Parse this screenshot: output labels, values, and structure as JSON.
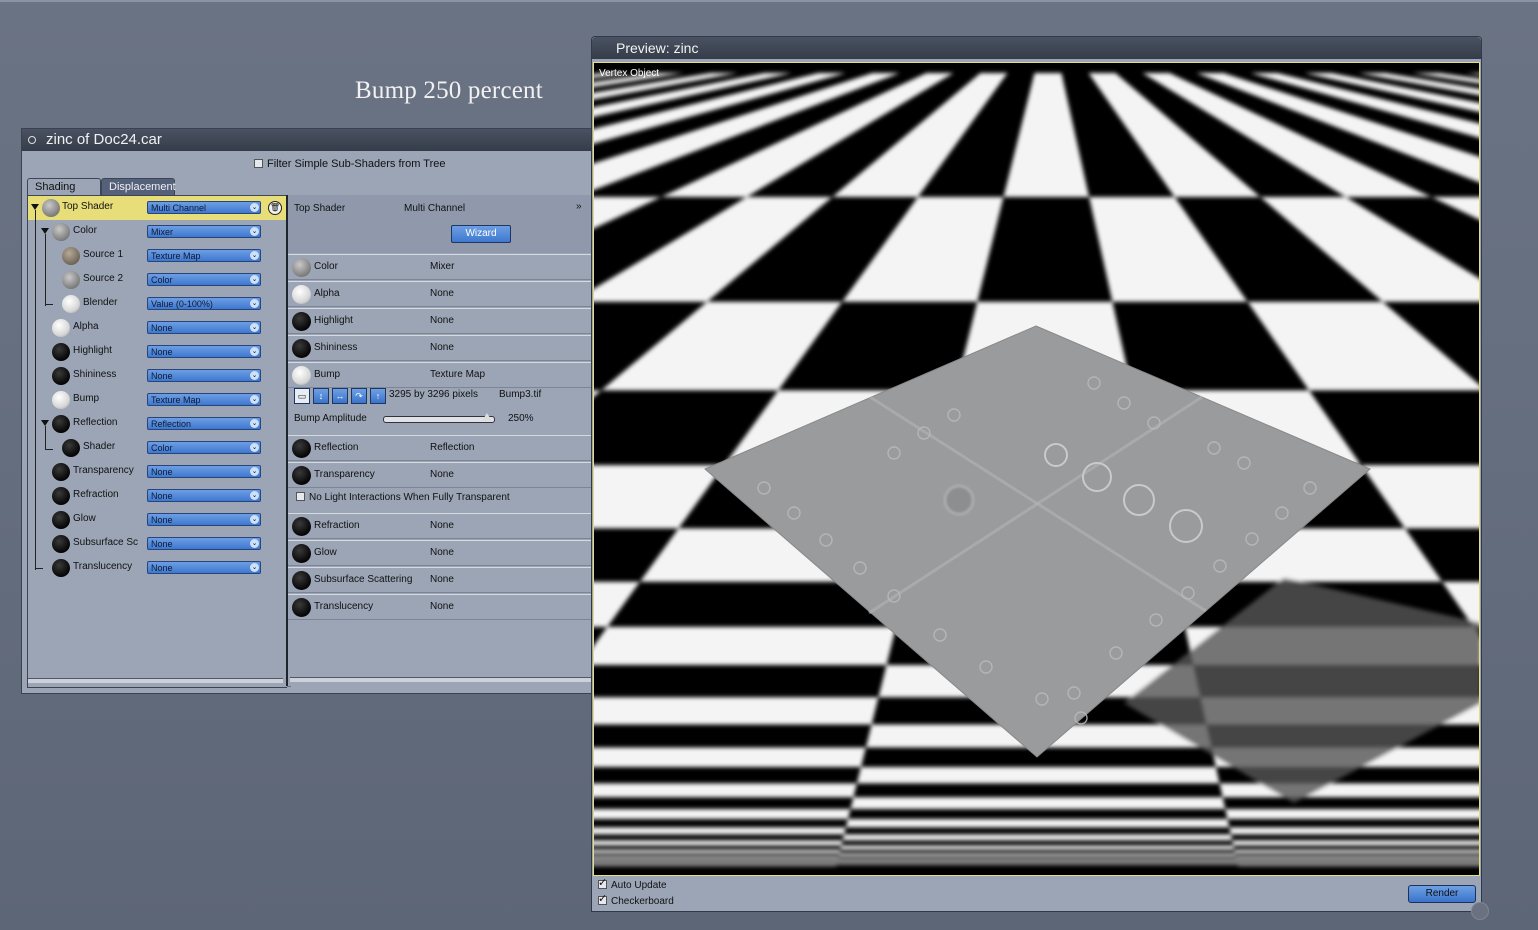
{
  "caption": "Bump 250 percent",
  "shader_window": {
    "title": "zinc of Doc24.car",
    "filter_label": "Filter Simple Sub-Shaders from Tree",
    "filter_checked": false,
    "tabs": [
      "Shading",
      "Displacement"
    ],
    "active_tab": "Shading",
    "tree": [
      {
        "label": "Top Shader",
        "value": "Multi Channel",
        "ball": "grey",
        "selected": true
      },
      {
        "label": "Color",
        "value": "Mixer",
        "ball": "grey"
      },
      {
        "label": "Source 1",
        "value": "Texture Map",
        "ball": "tex"
      },
      {
        "label": "Source 2",
        "value": "Color",
        "ball": "grey"
      },
      {
        "label": "Blender",
        "value": "Value (0-100%)",
        "ball": "white"
      },
      {
        "label": "Alpha",
        "value": "None",
        "ball": "white"
      },
      {
        "label": "Highlight",
        "value": "None",
        "ball": "black"
      },
      {
        "label": "Shininess",
        "value": "None",
        "ball": "black"
      },
      {
        "label": "Bump",
        "value": "Texture Map",
        "ball": "white"
      },
      {
        "label": "Reflection",
        "value": "Reflection",
        "ball": "black"
      },
      {
        "label": "Shader",
        "value": "Color",
        "ball": "black"
      },
      {
        "label": "Transparency",
        "value": "None",
        "ball": "black"
      },
      {
        "label": "Refraction",
        "value": "None",
        "ball": "black"
      },
      {
        "label": "Glow",
        "value": "None",
        "ball": "black"
      },
      {
        "label": "Subsurface Sc",
        "value": "None",
        "ball": "black"
      },
      {
        "label": "Translucency",
        "value": "None",
        "ball": "black"
      }
    ],
    "props": {
      "header_label": "Top Shader",
      "header_value": "Multi Channel",
      "wizard": "Wizard",
      "rows_a": [
        {
          "name": "Color",
          "value": "Mixer",
          "ball": "grey"
        },
        {
          "name": "Alpha",
          "value": "None",
          "ball": "white"
        },
        {
          "name": "Highlight",
          "value": "None",
          "ball": "black"
        },
        {
          "name": "Shininess",
          "value": "None",
          "ball": "black"
        },
        {
          "name": "Bump",
          "value": "Texture Map",
          "ball": "white"
        }
      ],
      "bump_size": "3295 by 3296 pixels",
      "bump_file": "Bump3.tif",
      "bump_amplitude_label": "Bump Amplitude",
      "bump_amplitude_value": "250%",
      "rows_b": [
        {
          "name": "Reflection",
          "value": "Reflection",
          "ball": "black"
        },
        {
          "name": "Transparency",
          "value": "None",
          "ball": "black"
        }
      ],
      "no_light_label": "No Light Interactions When Fully Transparent",
      "rows_c": [
        {
          "name": "Refraction",
          "value": "None",
          "ball": "black"
        },
        {
          "name": "Glow",
          "value": "None",
          "ball": "black"
        },
        {
          "name": "Subsurface Scattering",
          "value": "None",
          "ball": "black"
        },
        {
          "name": "Translucency",
          "value": "None",
          "ball": "black"
        }
      ]
    }
  },
  "preview_window": {
    "title": "Preview: zinc",
    "viewport_label": "Vertex Object",
    "auto_update_label": "Auto Update",
    "auto_update_checked": true,
    "checkerboard_label": "Checkerboard",
    "checkerboard_checked": true,
    "render_label": "Render"
  }
}
